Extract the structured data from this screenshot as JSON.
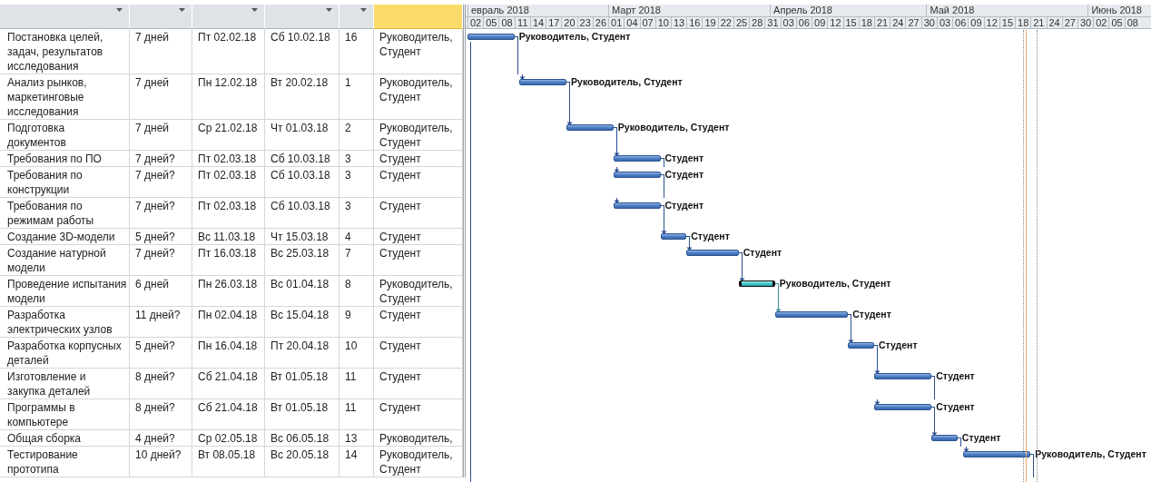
{
  "table": {
    "columns": [
      {
        "selected": false
      },
      {
        "selected": false
      },
      {
        "selected": false
      },
      {
        "selected": false
      },
      {
        "selected": false
      },
      {
        "selected": true
      }
    ],
    "rows": [
      {
        "name": "Постановка целей,\nзадач, результатов\nисследования",
        "duration": "7 дней",
        "start": "Пт 02.02.18",
        "finish": "Сб 10.02.18",
        "predecessors": "16",
        "resources": "Руководитель,\nСтудент",
        "bar_label": "Руководитель, Студент",
        "selected": false
      },
      {
        "name": "Анализ рынков,\nмаркетинговые\nисследования",
        "duration": "7 дней",
        "start": "Пн 12.02.18",
        "finish": "Вт 20.02.18",
        "predecessors": "1",
        "resources": "Руководитель,\nСтудент",
        "bar_label": "Руководитель, Студент",
        "selected": false
      },
      {
        "name": "Подготовка\nдокументов",
        "duration": "7 дней",
        "start": "Ср 21.02.18",
        "finish": "Чт 01.03.18",
        "predecessors": "2",
        "resources": "Руководитель,\nСтудент",
        "bar_label": "Руководитель, Студент",
        "selected": false
      },
      {
        "name": "Требования по ПО",
        "duration": "7 дней?",
        "start": "Пт 02.03.18",
        "finish": "Сб 10.03.18",
        "predecessors": "3",
        "resources": "Студент",
        "bar_label": "Студент",
        "selected": false
      },
      {
        "name": "Требования по\nконструкции",
        "duration": "7 дней?",
        "start": "Пт 02.03.18",
        "finish": "Сб 10.03.18",
        "predecessors": "3",
        "resources": "Студент",
        "bar_label": "Студент",
        "selected": false
      },
      {
        "name": "Требования по\nрежимам работы",
        "duration": "7 дней?",
        "start": "Пт 02.03.18",
        "finish": "Сб 10.03.18",
        "predecessors": "3",
        "resources": "Студент",
        "bar_label": "Студент",
        "selected": false
      },
      {
        "name": "Создание 3D-модели",
        "duration": "5 дней?",
        "start": "Вс 11.03.18",
        "finish": "Чт 15.03.18",
        "predecessors": "4",
        "resources": "Студент",
        "bar_label": "Студент",
        "selected": false
      },
      {
        "name": "Создание натурной\nмодели",
        "duration": "7 дней?",
        "start": "Пт 16.03.18",
        "finish": "Вс 25.03.18",
        "predecessors": "7",
        "resources": "Студент",
        "bar_label": "Студент",
        "selected": false
      },
      {
        "name": "Проведение испытания\nмодели",
        "duration": "6 дней",
        "start": "Пн 26.03.18",
        "finish": "Вс 01.04.18",
        "predecessors": "8",
        "resources": "Руководитель,\nСтудент",
        "bar_label": "Руководитель, Студент",
        "selected": true
      },
      {
        "name": "Разработка\nэлектрических узлов",
        "duration": "11 дней?",
        "start": "Пн 02.04.18",
        "finish": "Вс 15.04.18",
        "predecessors": "9",
        "resources": "Студент",
        "bar_label": "Студент",
        "selected": false
      },
      {
        "name": "Разработка корпусных\nдеталей",
        "duration": "5 дней?",
        "start": "Пн 16.04.18",
        "finish": "Пт 20.04.18",
        "predecessors": "10",
        "resources": "Студент",
        "bar_label": "Студент",
        "selected": false
      },
      {
        "name": "Изготовление и\nзакупка деталей",
        "duration": "8 дней?",
        "start": "Сб 21.04.18",
        "finish": "Вт 01.05.18",
        "predecessors": "11",
        "resources": "Студент",
        "bar_label": "Студент",
        "selected": false
      },
      {
        "name": "Программы в\nкомпьютере",
        "duration": "8 дней?",
        "start": "Сб 21.04.18",
        "finish": "Вт 01.05.18",
        "predecessors": "11",
        "resources": "Студент",
        "bar_label": "Студент",
        "selected": false
      },
      {
        "name": "Общая сборка",
        "duration": "4 дней?",
        "start": "Ср 02.05.18",
        "finish": "Вс 06.05.18",
        "predecessors": "13",
        "resources": "Руководитель,",
        "bar_label": "Студент",
        "selected": false
      },
      {
        "name": "Тестирование\nпрототипа",
        "duration": "10 дней?",
        "start": "Вт 08.05.18",
        "finish": "Вс 20.05.18",
        "predecessors": "14",
        "resources": "Руководитель,\nСтудент",
        "bar_label": "Руководитель, Студент",
        "selected": false
      }
    ]
  },
  "timescale": {
    "months": [
      "евраль 2018",
      "Март 2018",
      "Апрель 2018",
      "Май 2018",
      "Июнь 2018"
    ],
    "ticks": [
      "02",
      "05",
      "08",
      "11",
      "14",
      "17",
      "20",
      "23",
      "26",
      "01",
      "04",
      "07",
      "10",
      "13",
      "16",
      "19",
      "22",
      "25",
      "28",
      "31",
      "03",
      "06",
      "09",
      "12",
      "15",
      "18",
      "21",
      "24",
      "27",
      "30",
      "03",
      "06",
      "09",
      "12",
      "15",
      "18",
      "21",
      "24",
      "27",
      "30",
      "02",
      "05",
      "08"
    ]
  }
}
